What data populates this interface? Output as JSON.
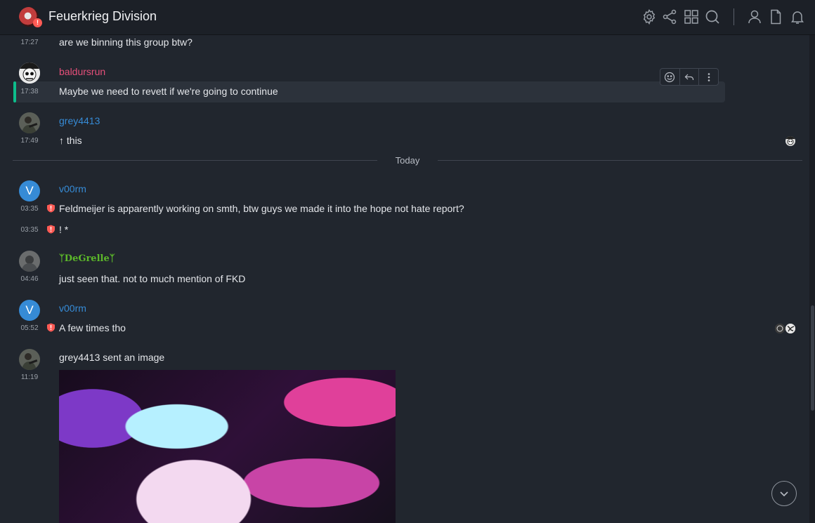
{
  "header": {
    "room_name": "Feuerkrieg Division",
    "room_badge": "!",
    "icons": [
      "settings-icon",
      "share-icon",
      "apps-grid-icon",
      "search-icon",
      "user-icon",
      "files-icon",
      "notifications-icon"
    ]
  },
  "timeline": {
    "messages": [
      {
        "time": "17:27",
        "body": "are we binning this group btw?"
      },
      {
        "sender": "baldursrun",
        "time": "17:38",
        "body": "Maybe we need to revett if we're going to continue"
      },
      {
        "sender": "grey4413",
        "time": "17:49",
        "body": "↑ this"
      },
      {
        "sender": "v00rm",
        "avatar_letter": "V",
        "time": "03:35",
        "body": "Feldmeijer is apparently working on smth, btw guys we made it into the hope not hate report?"
      },
      {
        "time": "03:35",
        "body": "! *"
      },
      {
        "sender": "ᛉDeGrelleᛉ",
        "time": "04:46",
        "body": "just seen that. not to much mention of FKD"
      },
      {
        "sender": "v00rm",
        "avatar_letter": "V",
        "time": "05:52",
        "body": "A few times tho"
      },
      {
        "time": "11:19",
        "body": "grey4413 sent an image"
      }
    ],
    "date_separator": "Today"
  },
  "colors": {
    "background": "#21262e",
    "header_bg": "#1c2027",
    "sender_baldursrun": "#e64f7a",
    "sender_grey4413": "#368bd6",
    "sender_v00rm": "#368bd6",
    "sender_degrelle": "#5cb82a",
    "warning_shield": "#ff5b55",
    "highlight_bar": "#0dbd8b"
  }
}
